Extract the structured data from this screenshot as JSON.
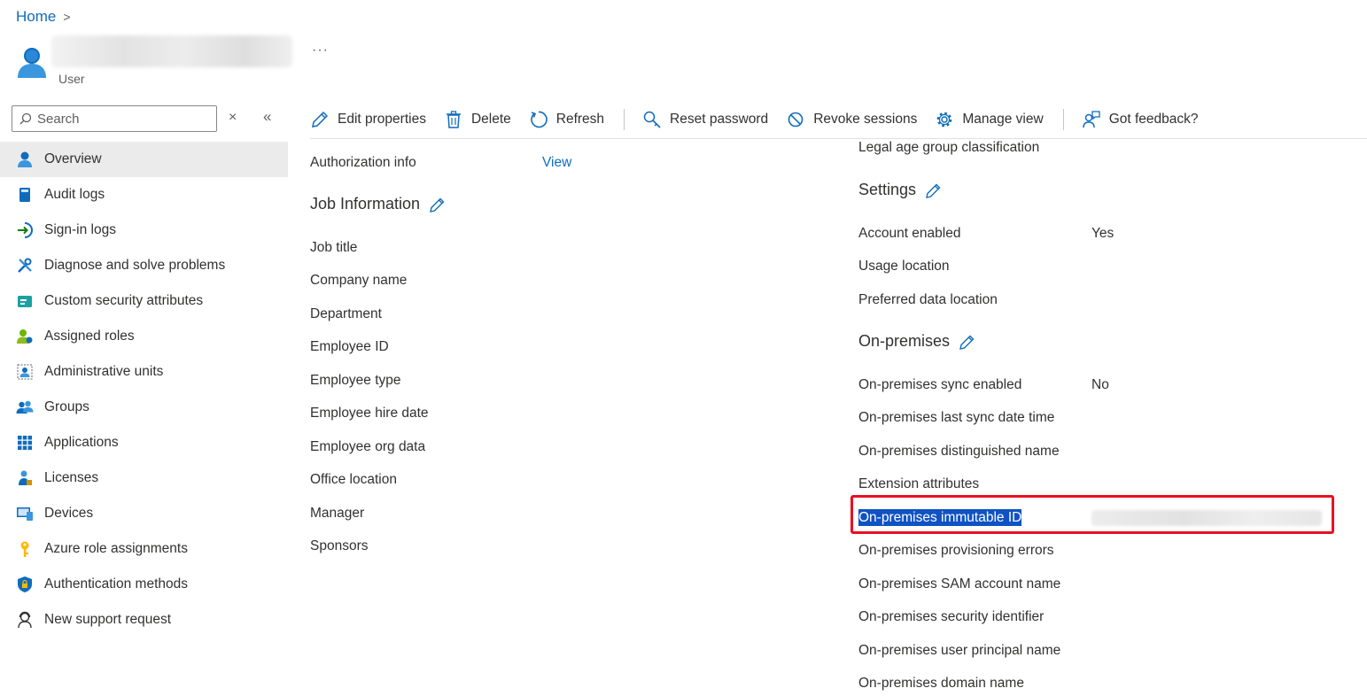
{
  "breadcrumb": {
    "home": "Home",
    "sep": ">"
  },
  "header": {
    "user_type": "User",
    "more": "···"
  },
  "search": {
    "placeholder": "Search"
  },
  "sidebar": {
    "close_glyph": "×",
    "collapse_glyph": "«",
    "items": [
      {
        "label": "Overview",
        "icon": "user-icon",
        "active": true
      },
      {
        "label": "Audit logs",
        "icon": "book-icon"
      },
      {
        "label": "Sign-in logs",
        "icon": "signin-arrow-icon"
      },
      {
        "label": "Diagnose and solve problems",
        "icon": "wrench-icon"
      },
      {
        "label": "Custom security attributes",
        "icon": "tag-card-icon"
      },
      {
        "label": "Assigned roles",
        "icon": "user-roles-icon"
      },
      {
        "label": "Administrative units",
        "icon": "admin-units-icon"
      },
      {
        "label": "Groups",
        "icon": "groups-icon"
      },
      {
        "label": "Applications",
        "icon": "apps-grid-icon"
      },
      {
        "label": "Licenses",
        "icon": "license-icon"
      },
      {
        "label": "Devices",
        "icon": "device-icon"
      },
      {
        "label": "Azure role assignments",
        "icon": "key-icon"
      },
      {
        "label": "Authentication methods",
        "icon": "shield-icon"
      },
      {
        "label": "New support request",
        "icon": "support-person-icon"
      }
    ]
  },
  "toolbar": {
    "edit": "Edit properties",
    "delete": "Delete",
    "refresh": "Refresh",
    "reset_password": "Reset password",
    "revoke_sessions": "Revoke sessions",
    "manage_view": "Manage view",
    "feedback": "Got feedback?"
  },
  "left_col": {
    "auth_info": "Authorization info",
    "auth_link": "View",
    "job_section": "Job Information",
    "fields": [
      "Job title",
      "Company name",
      "Department",
      "Employee ID",
      "Employee type",
      "Employee hire date",
      "Employee org data",
      "Office location",
      "Manager",
      "Sponsors"
    ]
  },
  "right_col": {
    "legal_age": "Legal age group classification",
    "settings_section": "Settings",
    "account_enabled": {
      "label": "Account enabled",
      "value": "Yes"
    },
    "usage_location": "Usage location",
    "preferred_data_location": "Preferred data location",
    "onprem_section": "On-premises",
    "sync_enabled": {
      "label": "On-premises sync enabled",
      "value": "No"
    },
    "fields": [
      "On-premises last sync date time",
      "On-premises distinguished name",
      "Extension attributes",
      "On-premises immutable ID",
      "On-premises provisioning errors",
      "On-premises SAM account name",
      "On-premises security identifier",
      "On-premises user principal name",
      "On-premises domain name"
    ]
  },
  "colors": {
    "accent": "#0f6cbd",
    "highlight": "#0f52c4",
    "annotation_red": "#e81123"
  }
}
